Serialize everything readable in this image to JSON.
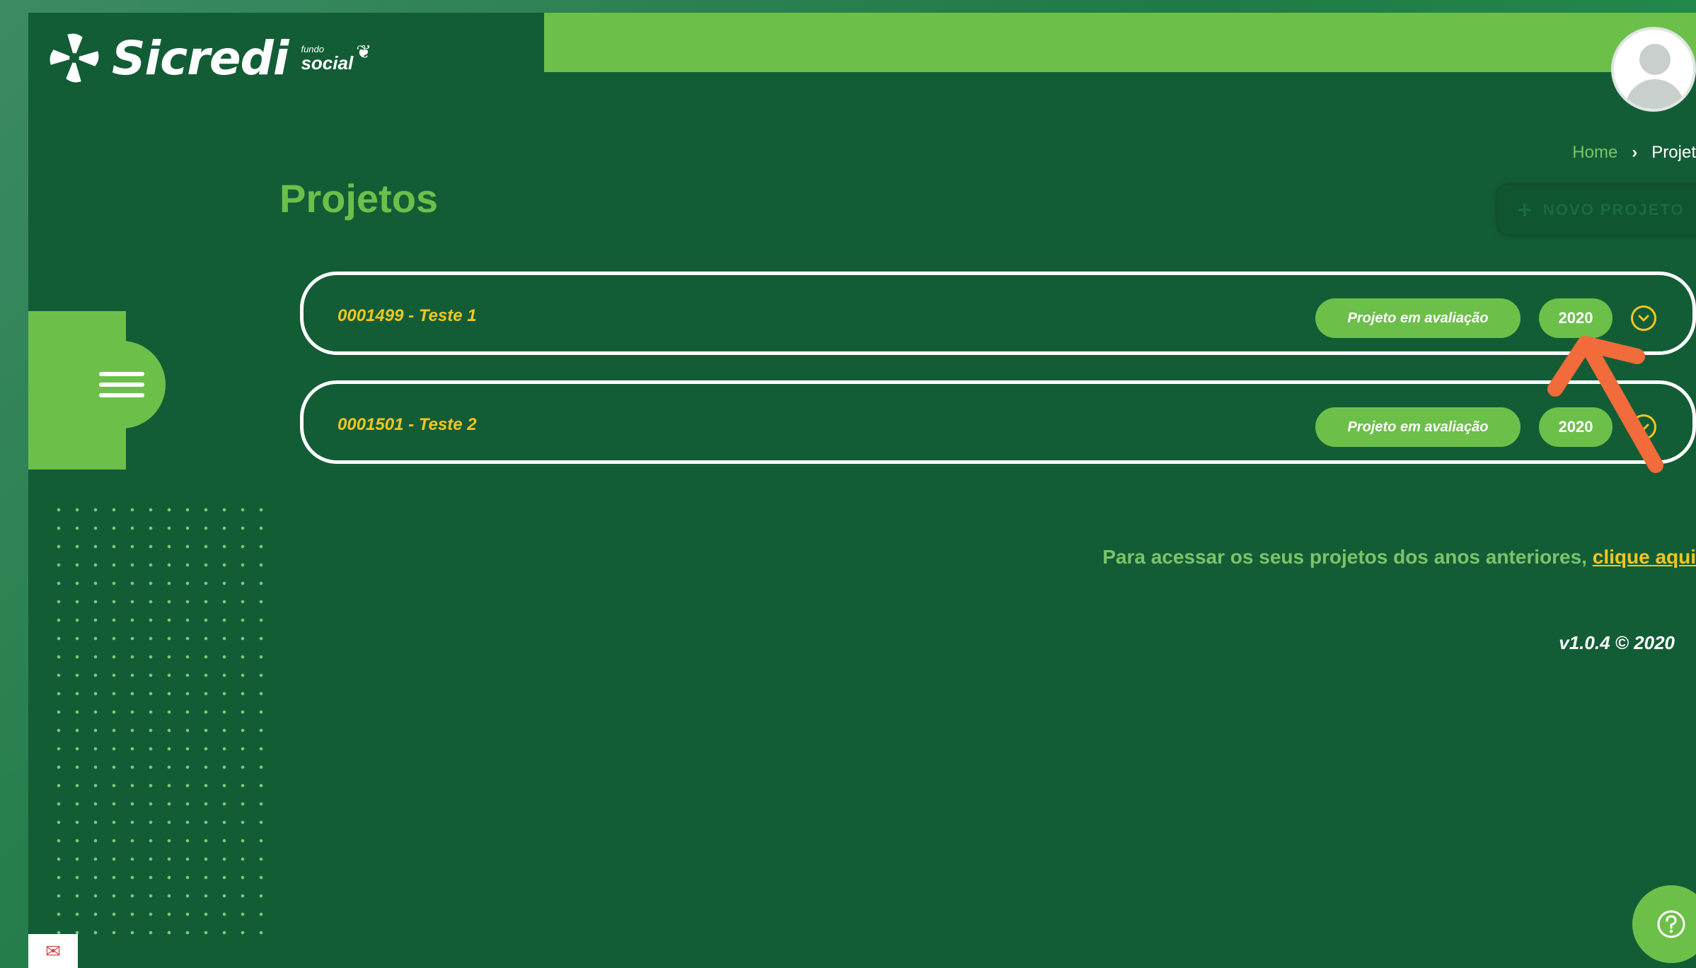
{
  "brand": {
    "name": "Sicredi",
    "sub_top": "fundo",
    "sub_bottom": "social"
  },
  "breadcrumb": {
    "home": "Home",
    "separator": "›",
    "current": "Projet"
  },
  "page": {
    "title": "Projetos",
    "new_button": "NOVO PROJETO"
  },
  "projects": [
    {
      "title": "0001499 - Teste 1",
      "status": "Projeto em avaliação",
      "year": "2020"
    },
    {
      "title": "0001501 - Teste 2",
      "status": "Projeto em avaliação",
      "year": "2020"
    }
  ],
  "notice": {
    "text": "Para acessar os seus projetos dos anos anteriores, ",
    "link": "clique aqui"
  },
  "footer": {
    "version": "v1.0.4 © 2020"
  },
  "colors": {
    "background": "#135d36",
    "accent": "#6cc04a",
    "highlight": "#f3c623",
    "arrow": "#f26b3a"
  },
  "icons": [
    "sicredi-logo-icon",
    "user-avatar-icon",
    "menu-icon",
    "chevron-down-icon",
    "help-icon",
    "arrow-annotation"
  ]
}
